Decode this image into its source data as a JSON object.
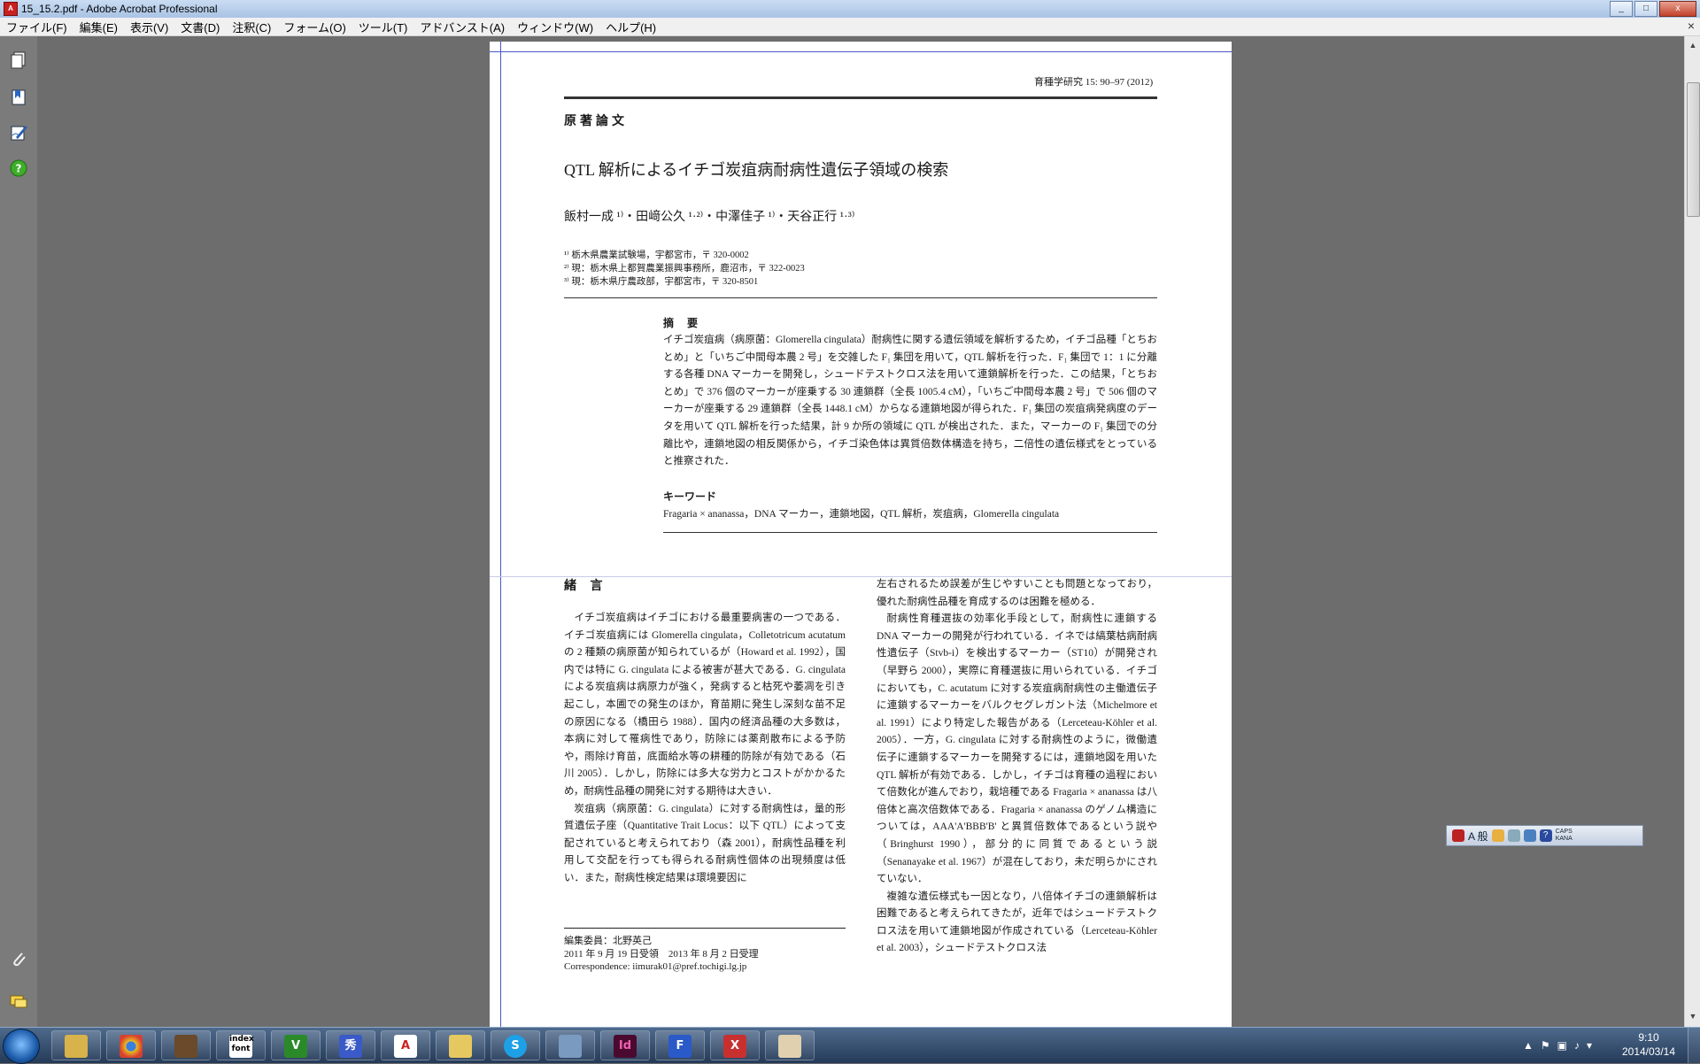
{
  "window": {
    "title": "15_15.2.pdf - Adobe Acrobat Professional",
    "buttons": [
      "_",
      "□",
      "x"
    ]
  },
  "menu": {
    "items": [
      "ファイル(F)",
      "編集(E)",
      "表示(V)",
      "文書(D)",
      "注釈(C)",
      "フォーム(O)",
      "ツール(T)",
      "アドバンスト(A)",
      "ウィンドウ(W)",
      "ヘルプ(H)"
    ],
    "close": "×"
  },
  "doc": {
    "journal": "育種学研究 15: 90–97 (2012)",
    "section_label": "原著論文",
    "title": "QTL 解析によるイチゴ炭疽病耐病性遺伝子領域の検索",
    "authors": "飯村一成 ¹⁾・田﨑公久 ¹·²⁾・中澤佳子 ¹⁾・天谷正行 ¹·³⁾",
    "affiliations": [
      "¹⁾ 栃木県農業試験場，宇都宮市，〒 320-0002",
      "²⁾ 現：栃木県上都賀農業振興事務所，鹿沼市，〒 322-0023",
      "³⁾ 現：栃木県庁農政部，宇都宮市，〒 320-8501"
    ],
    "abstract_heading": "摘 要",
    "abstract": "イチゴ炭疽病（病原菌：Glomerella cingulata）耐病性に関する遺伝領域を解析するため，イチゴ品種「とちおとめ」と「いちご中間母本農 2 号」を交雑した F₁ 集団を用いて，QTL 解析を行った．F₁ 集団で 1：1 に分離する各種 DNA マーカーを開発し，シュードテストクロス法を用いて連鎖解析を行った．この結果，「とちおとめ」で 376 個のマーカーが座乗する 30 連鎖群（全長 1005.4 cM），「いちご中間母本農 2 号」で 506 個のマーカーが座乗する 29 連鎖群（全長 1448.1 cM）からなる連鎖地図が得られた．F₁ 集団の炭疽病発病度のデータを用いて QTL 解析を行った結果，計 9 か所の領域に QTL が検出された．また，マーカーの F₁ 集団での分離比や，連鎖地図の相反関係から，イチゴ染色体は異質倍数体構造を持ち，二倍性の遺伝様式をとっていると推察された．",
    "keywords_heading": "キーワード",
    "keywords": "Fragaria × ananassa，DNA マーカー，連鎖地図，QTL 解析，炭疽病，Glomerella cingulata",
    "intro_heading": "緒 言",
    "intro_left": [
      "イチゴ炭疽病はイチゴにおける最重要病害の一つである．イチゴ炭疽病には Glomerella cingulata，Colletotricum acutatum の 2 種類の病原菌が知られているが（Howard et al. 1992），国内では特に G. cingulata による被害が甚大である．G. cingulata による炭疽病は病原力が強く，発病すると枯死や萎凋を引き起こし，本圃での発生のほか，育苗期に発生し深刻な苗不足の原因になる（橋田ら 1988）．国内の経済品種の大多数は，本病に対して罹病性であり，防除には薬剤散布による予防や，雨除け育苗，底面給水等の耕種的防除が有効である（石川 2005）．しかし，防除には多大な労力とコストがかかるため，耐病性品種の開発に対する期待は大きい．",
      "炭疽病（病原菌：G. cingulata）に対する耐病性は，量的形質遺伝子座（Quantitative Trait Locus：以下 QTL）によって支配されていると考えられており（森 2001），耐病性品種を利用して交配を行っても得られる耐病性個体の出現頻度は低い．また，耐病性検定結果は環境要因に"
    ],
    "intro_right": [
      "左右されるため誤差が生じやすいことも問題となっており，優れた耐病性品種を育成するのは困難を極める．",
      "耐病性育種選抜の効率化手段として，耐病性に連鎖する DNA マーカーの開発が行われている．イネでは縞葉枯病耐病性遺伝子（Stvb-i）を検出するマーカー（ST10）が開発され（早野ら 2000），実際に育種選抜に用いられている．イチゴにおいても，C. acutatum に対する炭疽病耐病性の主働遺伝子に連鎖するマーカーをバルクセグレガント法（Michelmore et al. 1991）により特定した報告がある（Lerceteau-Köhler et al. 2005）．一方，G. cingulata に対する耐病性のように，微働遺伝子に連鎖するマーカーを開発するには，連鎖地図を用いた QTL 解析が有効である．しかし，イチゴは育種の過程において倍数化が進んでおり，栽培種である Fragaria × ananassa は八倍体と高次倍数体である．Fragaria × ananassa のゲノム構造については，AAA'A'BBB'B' と異質倍数体であるという説や（Bringhurst 1990），部分的に同質であるという説（Senanayake et al. 1967）が混在しており，未だ明らかにされていない．",
      "複雑な遺伝様式も一因となり，八倍体イチゴの連鎖解析は困難であると考えられてきたが，近年ではシュードテストクロス法を用いて連鎖地図が作成されている（Lerceteau-Köhler et al. 2003），シュードテストクロス法"
    ],
    "footnote": [
      "編集委員：北野英己",
      "2011 年 9 月 19 日受領　2013 年 8 月 2 日受理",
      "Correspondence: iimurak01@pref.tochigi.lg.jp"
    ]
  },
  "ime": {
    "mode": "A 般",
    "caps": "CAPS",
    "kana": "KANA"
  },
  "taskbar": {
    "apps": [
      "explorer",
      "chrome",
      "library",
      "indexfont",
      "vim",
      "hidemaru",
      "acrobat",
      "folder",
      "skype",
      "remote",
      "indesign",
      "flash",
      "x-app",
      "paint"
    ],
    "index_label": "index font",
    "clock_time": "9:10",
    "clock_date": "2014/03/14"
  }
}
